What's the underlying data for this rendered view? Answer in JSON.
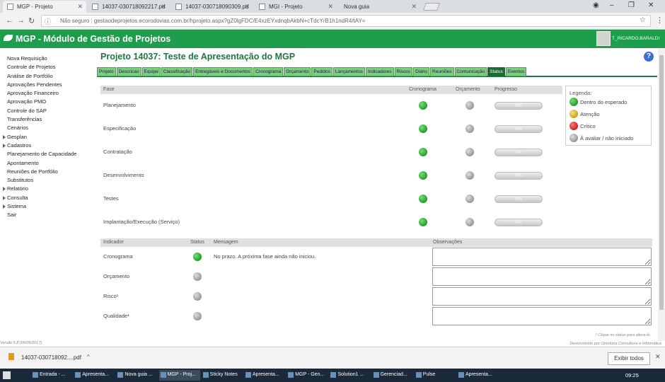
{
  "browser": {
    "tabs": [
      {
        "label": "MGP - Projeto",
        "active": true
      },
      {
        "label": "14037-030718092217.pd",
        "active": false
      },
      {
        "label": "14037-030718090309.pd",
        "active": false
      },
      {
        "label": "MGI - Projeto",
        "active": false
      },
      {
        "label": "Nova guia",
        "active": false
      }
    ],
    "security_label": "Não seguro",
    "url": "gestaodeprojetos.ecorodovias.com.br/hprojeto.aspx?gZ0lgFDC/E4xzEYxdnqbAkbN+cTdcYrB1h1ndR4/tAY="
  },
  "header": {
    "app_title": "MGP - Módulo de Gestão de Projetos",
    "user": "T_RICARDO.BARALDI"
  },
  "sidebar": {
    "items": [
      {
        "label": "Nova Requisição",
        "expandable": false
      },
      {
        "label": "Controle de Projetos",
        "expandable": false
      },
      {
        "label": "Análise de Portfólio",
        "expandable": false
      },
      {
        "label": "Aprovações Pendentes",
        "expandable": false
      },
      {
        "label": "Aprovação Financeiro",
        "expandable": false
      },
      {
        "label": "Aprovação PMO",
        "expandable": false
      },
      {
        "label": "Controle do SAP",
        "expandable": false
      },
      {
        "label": "Transferências",
        "expandable": false
      },
      {
        "label": "Cenários",
        "expandable": false
      },
      {
        "label": "Gesplan",
        "expandable": true
      },
      {
        "label": "Cadastros",
        "expandable": true
      },
      {
        "label": "Planejamento de Capacidade",
        "expandable": false
      },
      {
        "label": "Apontamento",
        "expandable": false
      },
      {
        "label": "Reuniões de Portfólio",
        "expandable": false
      },
      {
        "label": "Substitutos",
        "expandable": false
      },
      {
        "label": "Relatório",
        "expandable": true
      },
      {
        "label": "Consulta",
        "expandable": true
      },
      {
        "label": "Sistema",
        "expandable": true
      },
      {
        "label": "Sair",
        "expandable": false
      }
    ],
    "version": "Versão 5.8 (06/06/2017)"
  },
  "project": {
    "title": "Projeto 14037: Teste de Apresentação do MGP",
    "tabs": [
      "Projeto",
      "Descricao",
      "Equipe",
      "Classificação",
      "Entregáveis e Documentos",
      "Cronograma",
      "Orçamento",
      "Pedidos",
      "Lançamentos",
      "Indicadores",
      "Riscos",
      "Diário",
      "Reuniões",
      "Comunicação",
      "Status",
      "Eventos"
    ],
    "active_tab": "Status"
  },
  "phases": {
    "headers": {
      "fase": "Fase",
      "cronograma": "Cronograma",
      "orcamento": "Orçamento",
      "progresso": "Progresso"
    },
    "rows": [
      {
        "name": "Planejamento",
        "cronograma": "green",
        "orcamento": "grey",
        "progress": "0%"
      },
      {
        "name": "Especificação",
        "cronograma": "green",
        "orcamento": "grey",
        "progress": "0%"
      },
      {
        "name": "Contratação",
        "cronograma": "green",
        "orcamento": "grey",
        "progress": "0%"
      },
      {
        "name": "Desenvolvimento",
        "cronograma": "green",
        "orcamento": "grey",
        "progress": "0%"
      },
      {
        "name": "Testes",
        "cronograma": "green",
        "orcamento": "grey",
        "progress": "0%"
      },
      {
        "name": "Implantação/Execução (Serviço)",
        "cronograma": "green",
        "orcamento": "grey",
        "progress": "0%"
      }
    ]
  },
  "legend": {
    "title": "Legenda:",
    "items": [
      {
        "color": "green",
        "label": "Dentro do esperado"
      },
      {
        "color": "yellow",
        "label": "Atenção"
      },
      {
        "color": "red",
        "label": "Crítico"
      },
      {
        "color": "grey",
        "label": "À avaliar / não iniciado"
      }
    ]
  },
  "indicators": {
    "headers": {
      "indicador": "Indicador",
      "status": "Status",
      "mensagem": "Mensagem",
      "observacoes": "Observações"
    },
    "rows": [
      {
        "name": "Cronograma",
        "status": "green",
        "message": "No prazo. A próxima fase ainda não iniciou."
      },
      {
        "name": "Orçamento",
        "status": "grey",
        "message": ""
      },
      {
        "name": "Risco¹",
        "status": "grey",
        "message": ""
      },
      {
        "name": "Qualidade¹",
        "status": "grey",
        "message": ""
      }
    ],
    "note": "¹ Clique no status para altera-lo."
  },
  "footer": {
    "credit": "Desenvolvido por Oportuna Consultoria e Informática"
  },
  "download": {
    "file": "14037-030718092....pdf",
    "show_all": "Exibir todos"
  },
  "taskbar": {
    "items": [
      "Entrada - ...",
      "Apresenta...",
      "Nova guia ...",
      "MGP - Proj...",
      "Sticky Notes",
      "Apresenta...",
      "MGP - Gen...",
      "Solution1 ...",
      "Gerenciad...",
      "Pulse",
      "Apresenta..."
    ],
    "active_index": 3,
    "clock": "09:25"
  },
  "colors": {
    "brand_green": "#1e9e4d",
    "title_green": "#1a7a3c",
    "tab_green": "#7ecc7e"
  }
}
